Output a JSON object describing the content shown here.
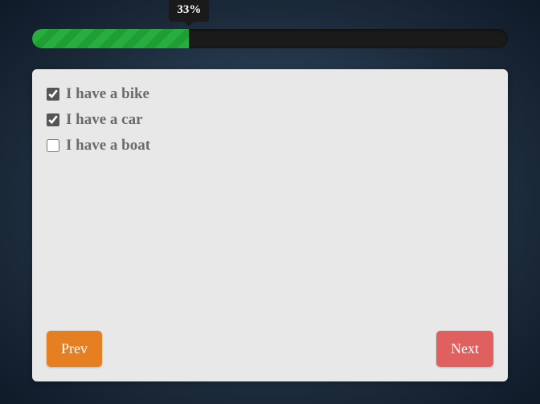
{
  "progress": {
    "percent_label": "33%",
    "percent_value": 33
  },
  "options": [
    {
      "label": "I have a bike",
      "checked": true
    },
    {
      "label": "I have a car",
      "checked": true
    },
    {
      "label": "I have a boat",
      "checked": false
    }
  ],
  "buttons": {
    "prev": "Prev",
    "next": "Next"
  }
}
